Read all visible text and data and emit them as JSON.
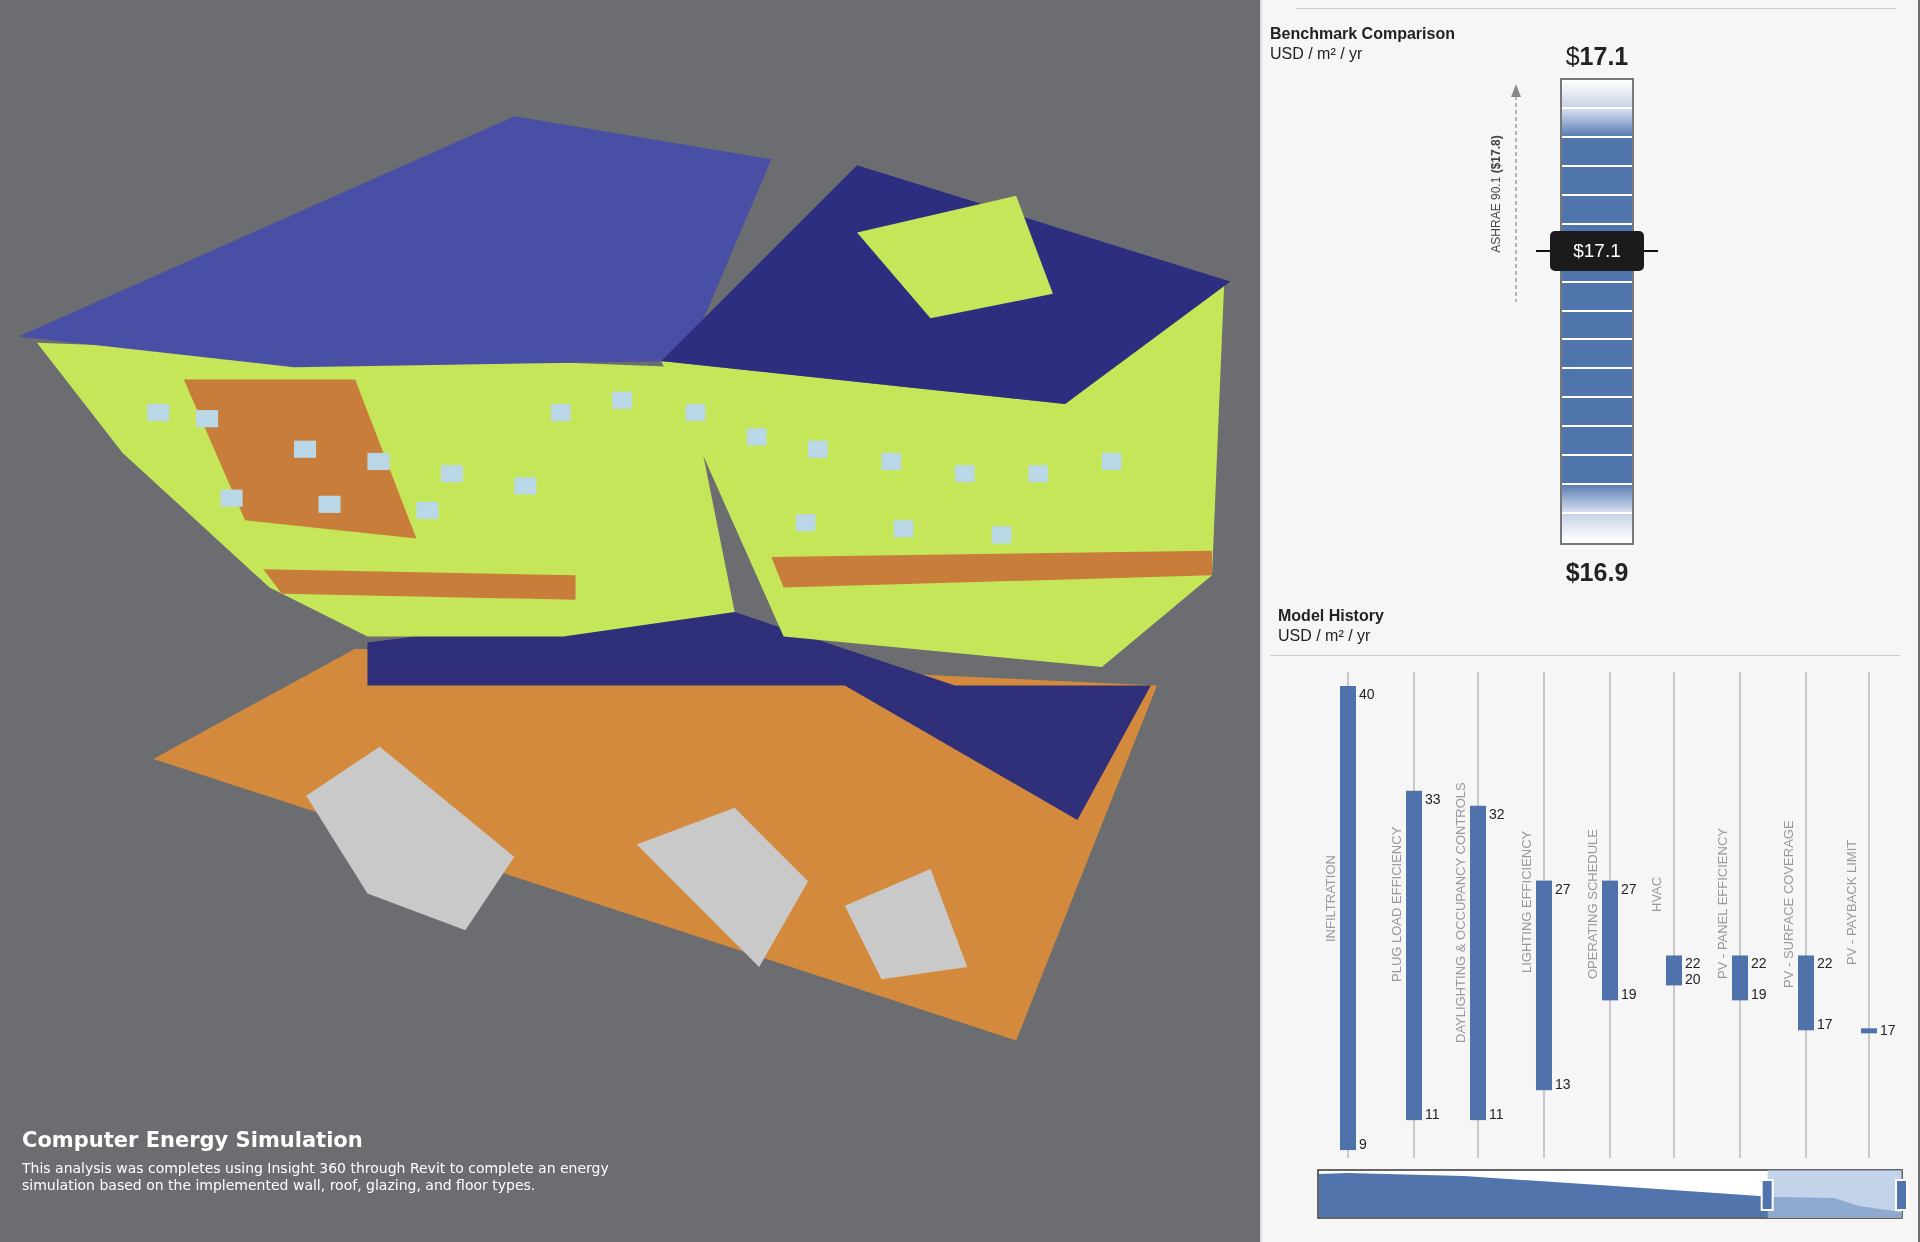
{
  "caption": {
    "title": "Computer Energy Simulation",
    "text": "This analysis was completes using Insight 360 through Revit to complete an energy simulation based on the implemented wall, roof, glazing, and floor types."
  },
  "benchmark": {
    "title": "Benchmark Comparison",
    "units": "USD / m² / yr",
    "top_value": "$**17.1**",
    "bottom_value": "$16.9",
    "reference_label": "ASHRAE 90.1 **($17.8)**",
    "marker": {
      "label": "$17.1",
      "level": 0.63
    }
  },
  "model_history": {
    "title": "Model History",
    "units": "USD / m² / yr",
    "steps": [
      {
        "label": "INFILTRATION",
        "values": [
          "40",
          "9"
        ]
      },
      {
        "label": "PLUG LOAD EFFICIENCY",
        "values": [
          "33",
          "11"
        ]
      },
      {
        "label": "DAYLIGHTING & OCCUPANCY CONTROLS",
        "values": [
          "32",
          "11"
        ]
      },
      {
        "label": "LIGHTING EFFICIENCY",
        "values": [
          "27",
          "13"
        ]
      },
      {
        "label": "OPERATING SCHEDULE",
        "values": [
          "27",
          "19"
        ]
      },
      {
        "label": "HVAC",
        "values": [
          "22",
          "20"
        ]
      },
      {
        "label": "PV - PANEL EFFICIENCY",
        "values": [
          "22",
          "19"
        ]
      },
      {
        "label": "PV - SURFACE COVERAGE",
        "values": [
          "22",
          "17"
        ]
      },
      {
        "label": "PV - PAYBACK LIMIT",
        "values": [
          "17"
        ]
      }
    ]
  }
}
